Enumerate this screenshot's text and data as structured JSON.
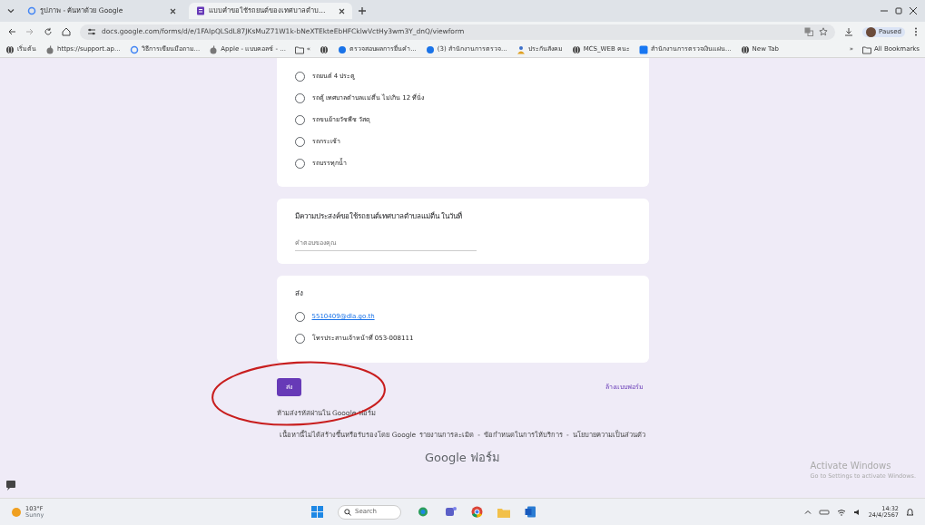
{
  "browser": {
    "tabs": [
      {
        "title": "รูปภาพ - ค้นหาด้วย Google",
        "selected": false
      },
      {
        "title": "แบบคำขอใช้รถยนต์ของเทศบาลตำบ…",
        "selected": true
      }
    ],
    "address": "docs.google.com/forms/d/e/1FAIpQLSdL87JKsMuZ71W1k-bNeXTEkteEbHFCklwVctHy3wm3Y_dnQ/viewform",
    "profile": "Paused",
    "bookmarks": [
      {
        "label": "เริ่มต้น"
      },
      {
        "label": "https://support.ap..."
      },
      {
        "label": "วิธีการเขียนมือถาม..."
      },
      {
        "label": "Apple - แบบคอลซ์ - ..."
      },
      {
        "label": "«"
      },
      {
        "label": "ตรวจสอบผลการยื่นคำ..."
      },
      {
        "label": "(3) สำนักงานการตรวจ..."
      },
      {
        "label": "ประกันสังคม"
      },
      {
        "label": "MCS_WEB คนะ"
      },
      {
        "label": "สำนักงานการตรวจเงินแผ่น..."
      },
      {
        "label": "New Tab"
      }
    ],
    "bookmarks_more": "»",
    "all_bookmarks": "All Bookmarks"
  },
  "form": {
    "sections": [
      {
        "options": [
          {
            "label": "รถยนต์ 4 ประตู",
            "selected": false
          },
          {
            "label": "รถตู้ เทศบาลตำบลแม่ตื่น ไม่เกิน 12 ที่นั่ง",
            "selected": false
          },
          {
            "label": "รถขนย้ายวัชพืช วัสดุ",
            "selected": false
          },
          {
            "label": "รถกระเช้า",
            "selected": false
          },
          {
            "label": "รถบรรทุกน้ำ",
            "selected": false
          }
        ]
      },
      {
        "question": "มีความประสงค์ขอใช้รถยนต์เทศบาลตำบลแม่ตื่น ในวันที่",
        "placeholder": "คำตอบของคุณ"
      },
      {
        "question": "ส่ง",
        "options": [
          {
            "label": "5510409@dla.go.th",
            "kind": "link",
            "selected": false
          },
          {
            "label": "โทรประสานเจ้าหน้าที่ 053-008111",
            "kind": "text",
            "selected": false
          }
        ]
      }
    ],
    "submit": "ส่ง",
    "clear": "ล้างแบบฟอร์ม",
    "password_note": "ห้ามส่งรหัสผ่านใน Google ฟอร์ม",
    "disclaimer": "เนื้อหานี้ไม่ได้สร้างขึ้นหรือรับรองโดย Google",
    "footer_links": [
      "รายงานการละเมิด",
      "ข้อกำหนดในการให้บริการ",
      "นโยบายความเป็นส่วนตัว"
    ],
    "footer_separators": [
      "-",
      "-"
    ],
    "brand": "Google",
    "brand_suffix": "ฟอร์ม"
  },
  "activation": {
    "title": "Activate Windows",
    "hint": "Go to Settings to activate Windows."
  },
  "taskbar": {
    "temperature": "103°F",
    "weather": "Sunny",
    "search": "Search",
    "time": "14:32",
    "date": "24/4/2567"
  }
}
